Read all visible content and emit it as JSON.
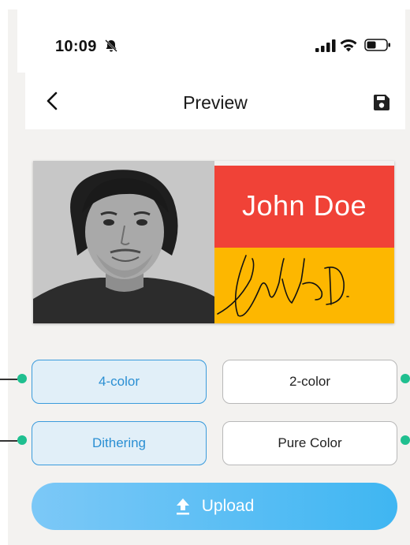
{
  "status_bar": {
    "time": "10:09"
  },
  "nav": {
    "title": "Preview"
  },
  "badge": {
    "name": "John Doe"
  },
  "options": {
    "four_color": "4-color",
    "two_color": "2-color",
    "dithering": "Dithering",
    "pure_color": "Pure Color"
  },
  "upload": {
    "label": "Upload"
  },
  "colors": {
    "accent": "#3a9bdc",
    "red_panel": "#f04237",
    "yellow_panel": "#fdb700",
    "indicator_dot": "#1fbf8f"
  },
  "icons": {
    "back": "chevron-left-icon",
    "save": "floppy-disk-icon",
    "bell": "bell-slash-icon",
    "upload": "upload-icon"
  }
}
